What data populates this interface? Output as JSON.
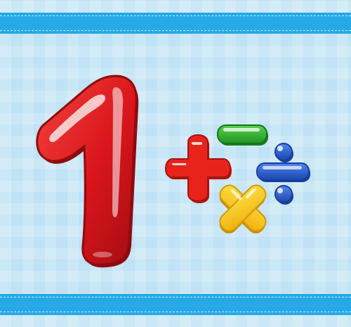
{
  "scene": {
    "background_color": "#bfe2f4",
    "band_color": "#26a9e6",
    "elements": [
      {
        "name": "number-one-icon",
        "color": "#d9151b"
      },
      {
        "name": "plus-icon",
        "color": "#e8231c"
      },
      {
        "name": "minus-icon",
        "color": "#2fb030"
      },
      {
        "name": "multiply-icon",
        "color": "#f6c516"
      },
      {
        "name": "divide-icon",
        "color": "#2756c7"
      }
    ]
  }
}
